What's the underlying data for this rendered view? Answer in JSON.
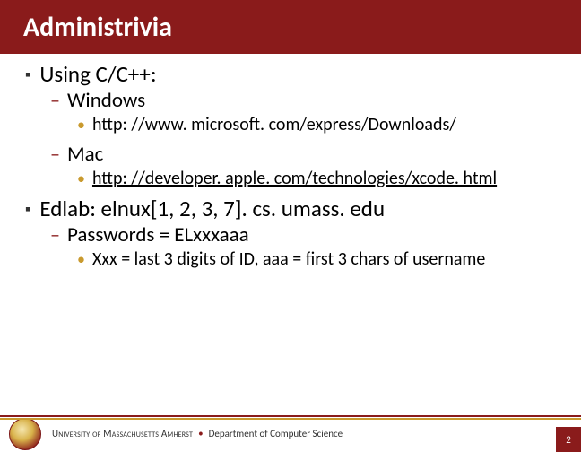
{
  "title": "Administrivia",
  "body": {
    "items": [
      {
        "label": "Using C/C++:",
        "children": [
          {
            "label": "Windows",
            "children": [
              {
                "label": "http: //www. microsoft. com/express/Downloads/",
                "link": false
              }
            ]
          },
          {
            "label": "Mac",
            "children": [
              {
                "label": "http: //developer. apple. com/technologies/xcode. html",
                "link": true
              }
            ]
          }
        ]
      },
      {
        "label": "Edlab: elnux[1, 2, 3, 7]. cs. umass. edu",
        "children": [
          {
            "label": "Passwords = ELxxxaaa",
            "children": [
              {
                "label": "Xxx = last 3 digits of ID, aaa = first 3 chars of username",
                "link": false
              }
            ]
          }
        ]
      }
    ]
  },
  "footer": {
    "university": "University of Massachusetts Amherst",
    "separator": "•",
    "department": "Department of Computer Science",
    "page": "2"
  },
  "bullets": {
    "l1": "▪",
    "l2": "–",
    "l3": "•"
  }
}
